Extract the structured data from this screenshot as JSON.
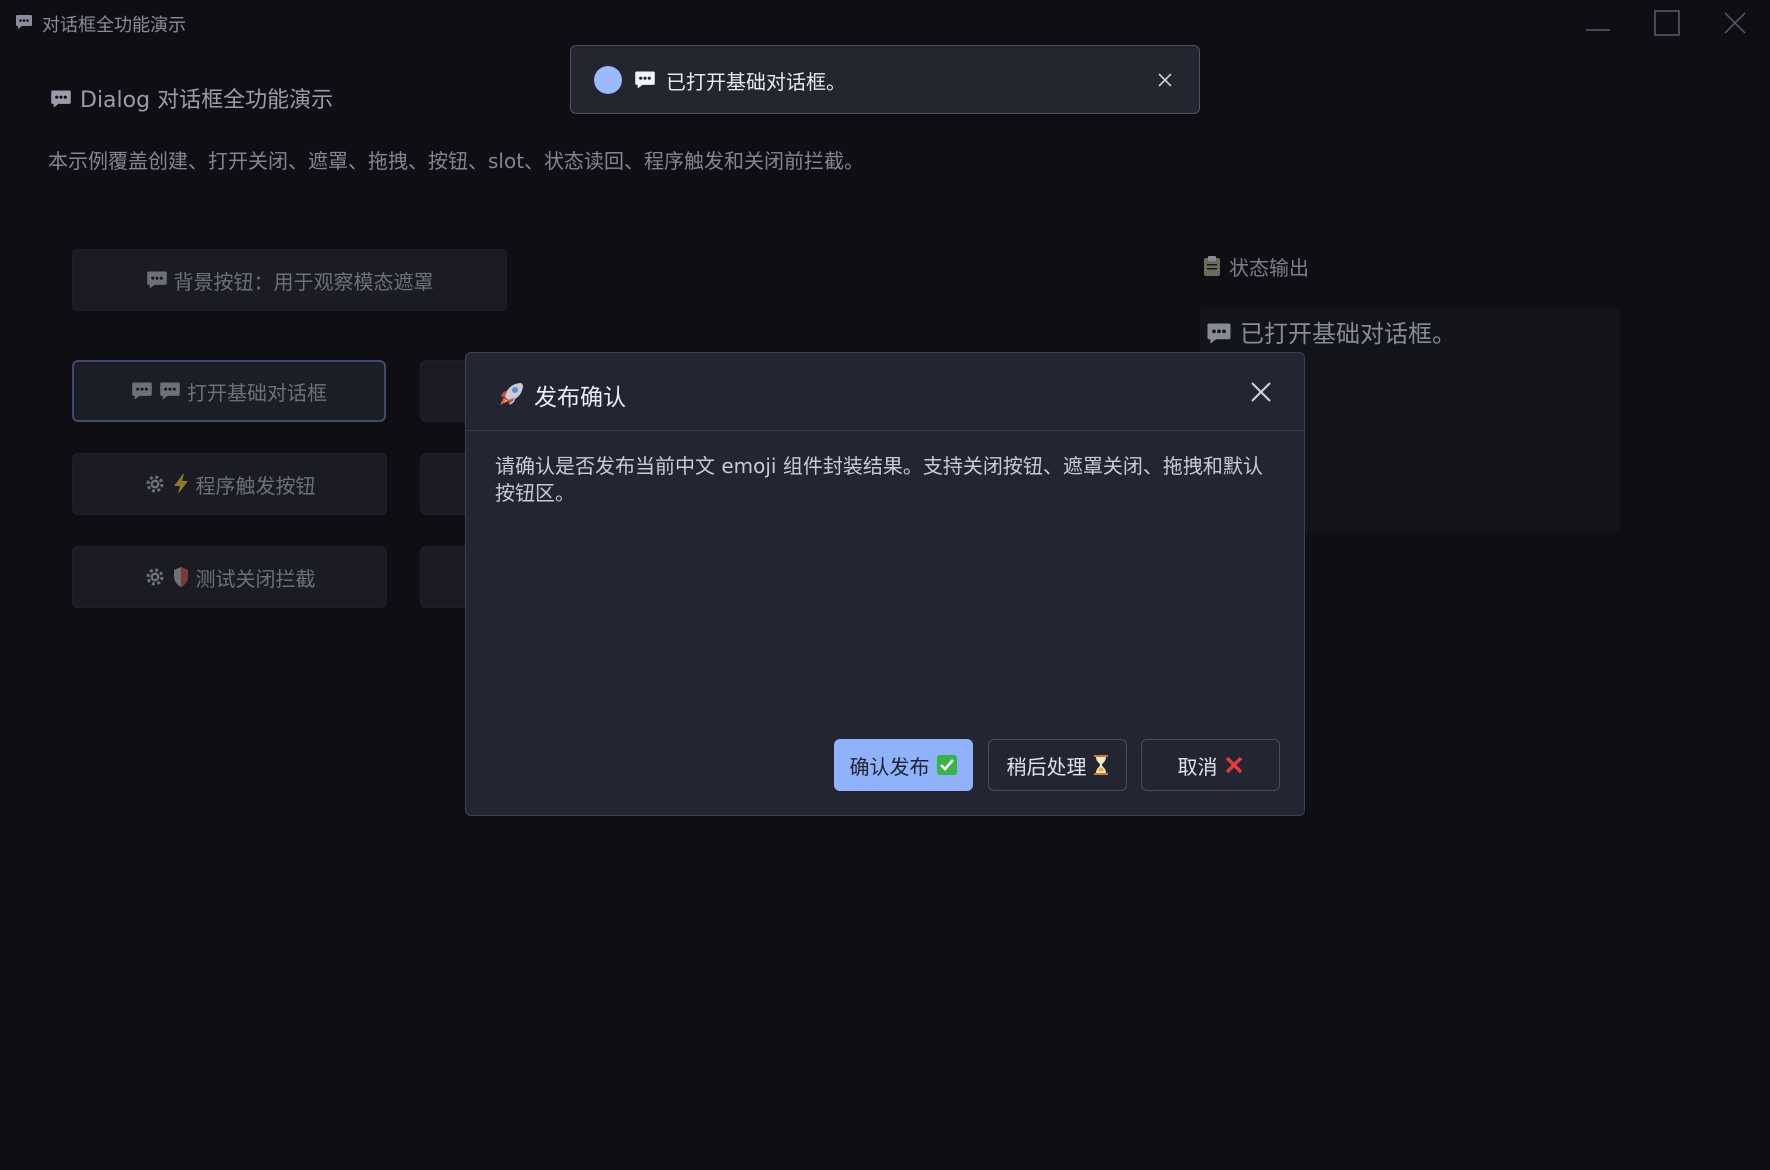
{
  "window": {
    "title": "对话框全功能演示",
    "icon": "speech-bubble-icon"
  },
  "page": {
    "heading": "Dialog 对话框全功能演示",
    "description": "本示例覆盖创建、打开关闭、遮罩、拖拽、按钮、slot、状态读回、程序触发和关闭前拦截。"
  },
  "buttons": {
    "background": "背景按钮：用于观察模态遮罩",
    "open_basic": "打开基础对话框",
    "program_trigger": "程序触发按钮",
    "test_intercept": "测试关闭拦截"
  },
  "status": {
    "title": "状态输出",
    "message": "已打开基础对话框。"
  },
  "toast": {
    "message": "已打开基础对话框。"
  },
  "dialog": {
    "title": "发布确认",
    "body": "请确认是否发布当前中文 emoji 组件封装结果。支持关闭按钮、遮罩关闭、拖拽和默认按钮区。",
    "confirm_label": "确认发布",
    "later_label": "稍后处理",
    "cancel_label": "取消"
  },
  "colors": {
    "background": "#0e0e14",
    "primary": "#8fb2fb",
    "dialog_bg": "#242533",
    "toast_dot": "#9cb9ff"
  }
}
